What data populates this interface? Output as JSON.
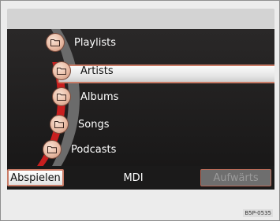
{
  "menu": {
    "items": [
      {
        "label": "Playlists",
        "icon": "folder-icon",
        "selected": false
      },
      {
        "label": "Artists",
        "icon": "folder-icon",
        "selected": true
      },
      {
        "label": "Albums",
        "icon": "folder-icon",
        "selected": false
      },
      {
        "label": "Songs",
        "icon": "folder-icon",
        "selected": false
      },
      {
        "label": "Podcasts",
        "icon": "folder-icon",
        "selected": false
      }
    ]
  },
  "bottom_bar": {
    "play_label": "Abspielen",
    "source_label": "MDI",
    "up_label": "Aufwärts"
  },
  "figure_code": "B5P-0535",
  "colors": {
    "accent_red": "#c81f1f",
    "highlight_border": "#c97b66",
    "screen_bg": "#1e1d1d"
  }
}
